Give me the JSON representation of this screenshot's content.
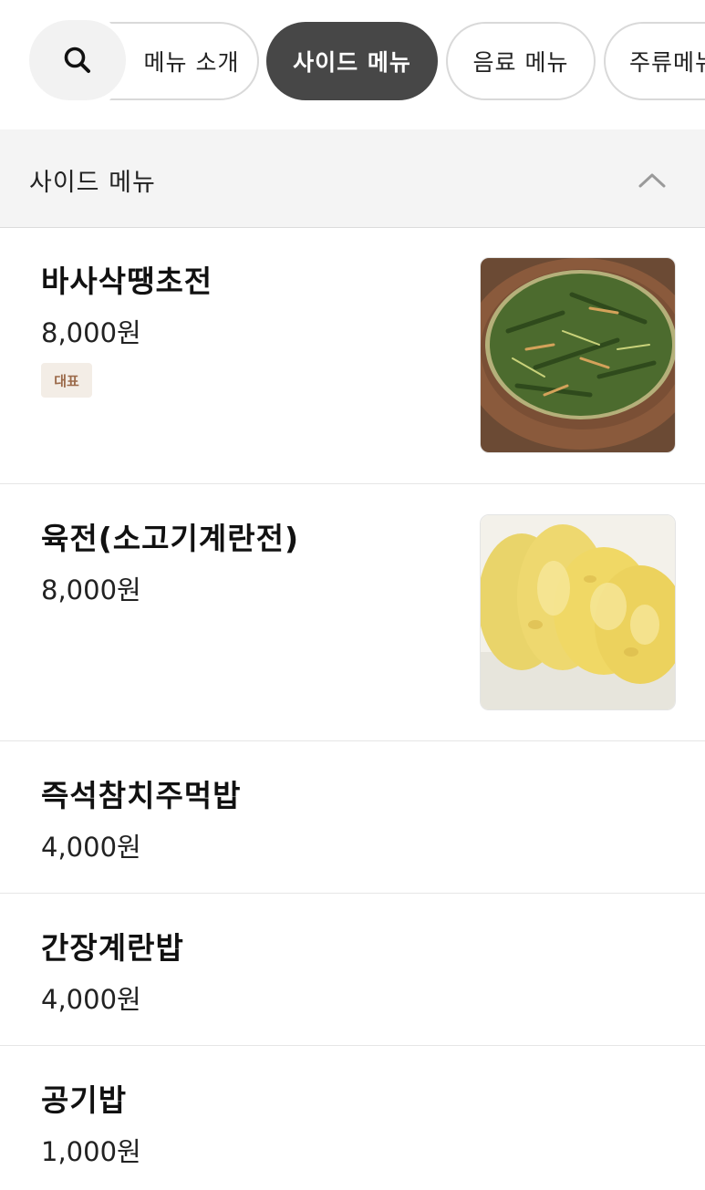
{
  "tabs": [
    {
      "label": "메뉴 소개",
      "active": false
    },
    {
      "label": "사이드 메뉴",
      "active": true
    },
    {
      "label": "음료 메뉴",
      "active": false
    },
    {
      "label": "주류메뉴",
      "active": false
    }
  ],
  "section": {
    "title": "사이드 메뉴"
  },
  "items": [
    {
      "name": "바사삭땡초전",
      "price": "8,000원",
      "badge": "대표",
      "image": "green chive pancake on brown plate"
    },
    {
      "name": "육전(소고기계란전)",
      "price": "8,000원",
      "image": "yellow egg-battered beef patties"
    },
    {
      "name": "즉석참치주먹밥",
      "price": "4,000원"
    },
    {
      "name": "간장계란밥",
      "price": "4,000원"
    },
    {
      "name": "공기밥",
      "price": "1,000원"
    }
  ],
  "colors": {
    "active_chip": "#474747",
    "section_bg": "#f4f4f4",
    "badge_bg": "#f3ede6",
    "badge_text": "#9b6a4a"
  }
}
